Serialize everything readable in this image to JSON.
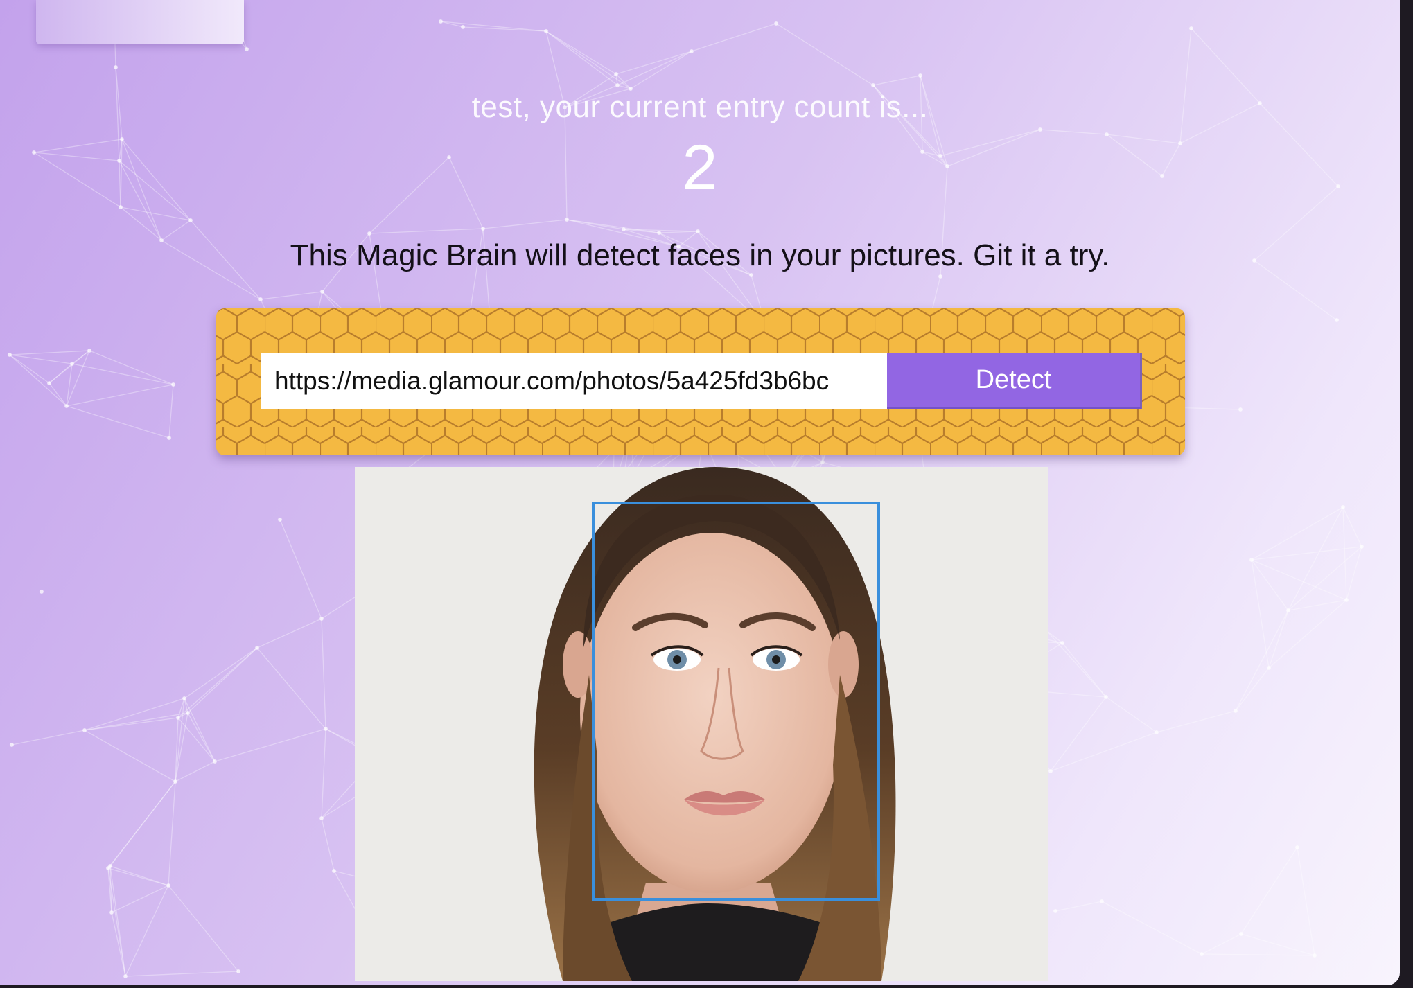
{
  "rank": {
    "message": "test, your current entry count is...",
    "count": "2"
  },
  "intro": {
    "text": "This Magic Brain will detect faces in your pictures. Git it a try."
  },
  "form": {
    "input_value": "https://media.glamour.com/photos/5a425fd3b6bc",
    "button_label": "Detect"
  },
  "result": {
    "image_description_icon": "portrait-photo",
    "faces_detected": 1
  },
  "colors": {
    "background_start": "#c3a2ec",
    "background_end": "#f8f4fd",
    "panel": "#f4b942",
    "button": "#9266e3",
    "face_box": "#3a8fdc"
  }
}
